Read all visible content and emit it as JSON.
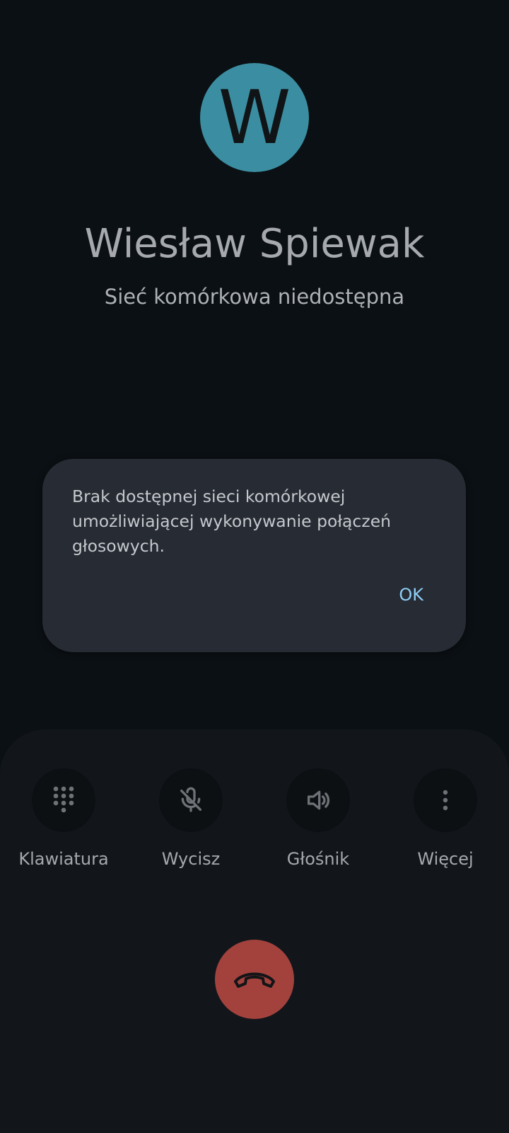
{
  "contact": {
    "initial": "W",
    "name": "Wiesław Spiewak",
    "status": "Sieć komórkowa niedostępna"
  },
  "dialog": {
    "message": "Brak dostępnej sieci komórkowej umożliwiającej wykonywanie połączeń głosowych.",
    "ok_label": "OK"
  },
  "controls": [
    {
      "label": "Klawiatura",
      "icon": "dialpad-icon"
    },
    {
      "label": "Wycisz",
      "icon": "mic-off-icon"
    },
    {
      "label": "Głośnik",
      "icon": "speaker-icon"
    },
    {
      "label": "Więcej",
      "icon": "more-vert-icon"
    }
  ],
  "end_call": {
    "icon": "call-end-icon"
  },
  "colors": {
    "background": "#0b1014",
    "avatar": "#3b8ea1",
    "dialog": "#272b33",
    "accent": "#8dcdf5",
    "end_call": "#a3423d"
  }
}
